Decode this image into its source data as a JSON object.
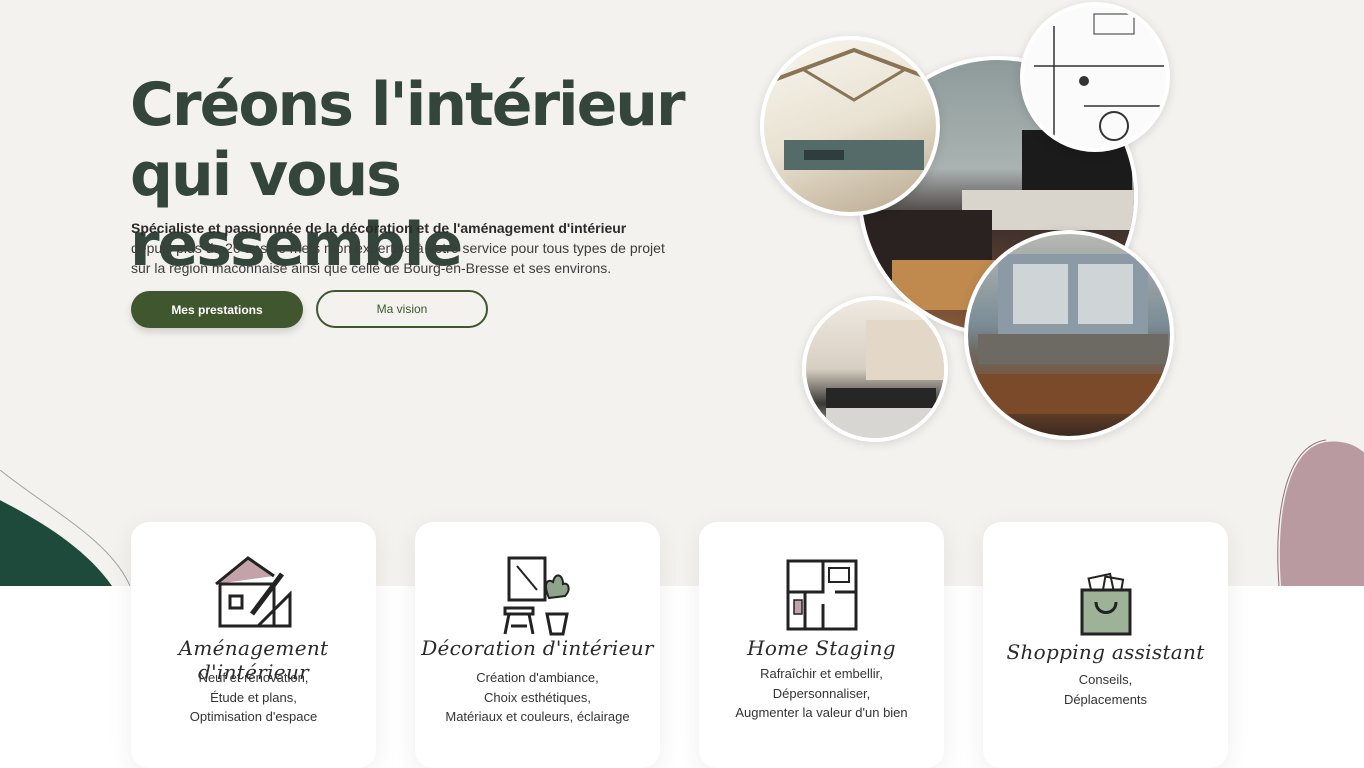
{
  "hero": {
    "title_line1": "Créons l'intérieur",
    "title_line2": "qui vous ressemble",
    "intro_bold": "Spécialiste et passionnée de la décoration et de l'aménagement d'intérieur",
    "intro_rest": " depuis plus de 20 ans, je mets mon expertise à votre service pour tous types de projet sur la région maconnaise ainsi que celle de Bourg-en-Bresse et ses environs.",
    "primary_button": "Mes prestations",
    "secondary_button": "Ma vision"
  },
  "colors": {
    "accent_green": "#40562f",
    "title_green": "#34463c",
    "blob_green": "#1d4a3a",
    "blob_mauve": "#b99aa0",
    "background": "#f4f2ef"
  },
  "services": [
    {
      "title": "Aménagement d'intérieur",
      "icon": "house-plan-icon",
      "lines": [
        "Neuf et rénovation,",
        "Étude et plans,",
        "Optimisation d'espace"
      ]
    },
    {
      "title": "Décoration d'intérieur",
      "icon": "decor-plant-stool-icon",
      "lines": [
        "Création d'ambiance,",
        "Choix esthétiques,",
        "Matériaux et couleurs, éclairage"
      ]
    },
    {
      "title": "Home Staging",
      "icon": "floor-plan-icon",
      "lines": [
        "Rafraîchir et embellir,",
        "Dépersonnaliser,",
        "Augmenter la valeur d'un bien"
      ]
    },
    {
      "title": "Shopping assistant",
      "icon": "shopping-bag-icon",
      "lines": [
        "Conseils,",
        "Déplacements"
      ]
    }
  ]
}
